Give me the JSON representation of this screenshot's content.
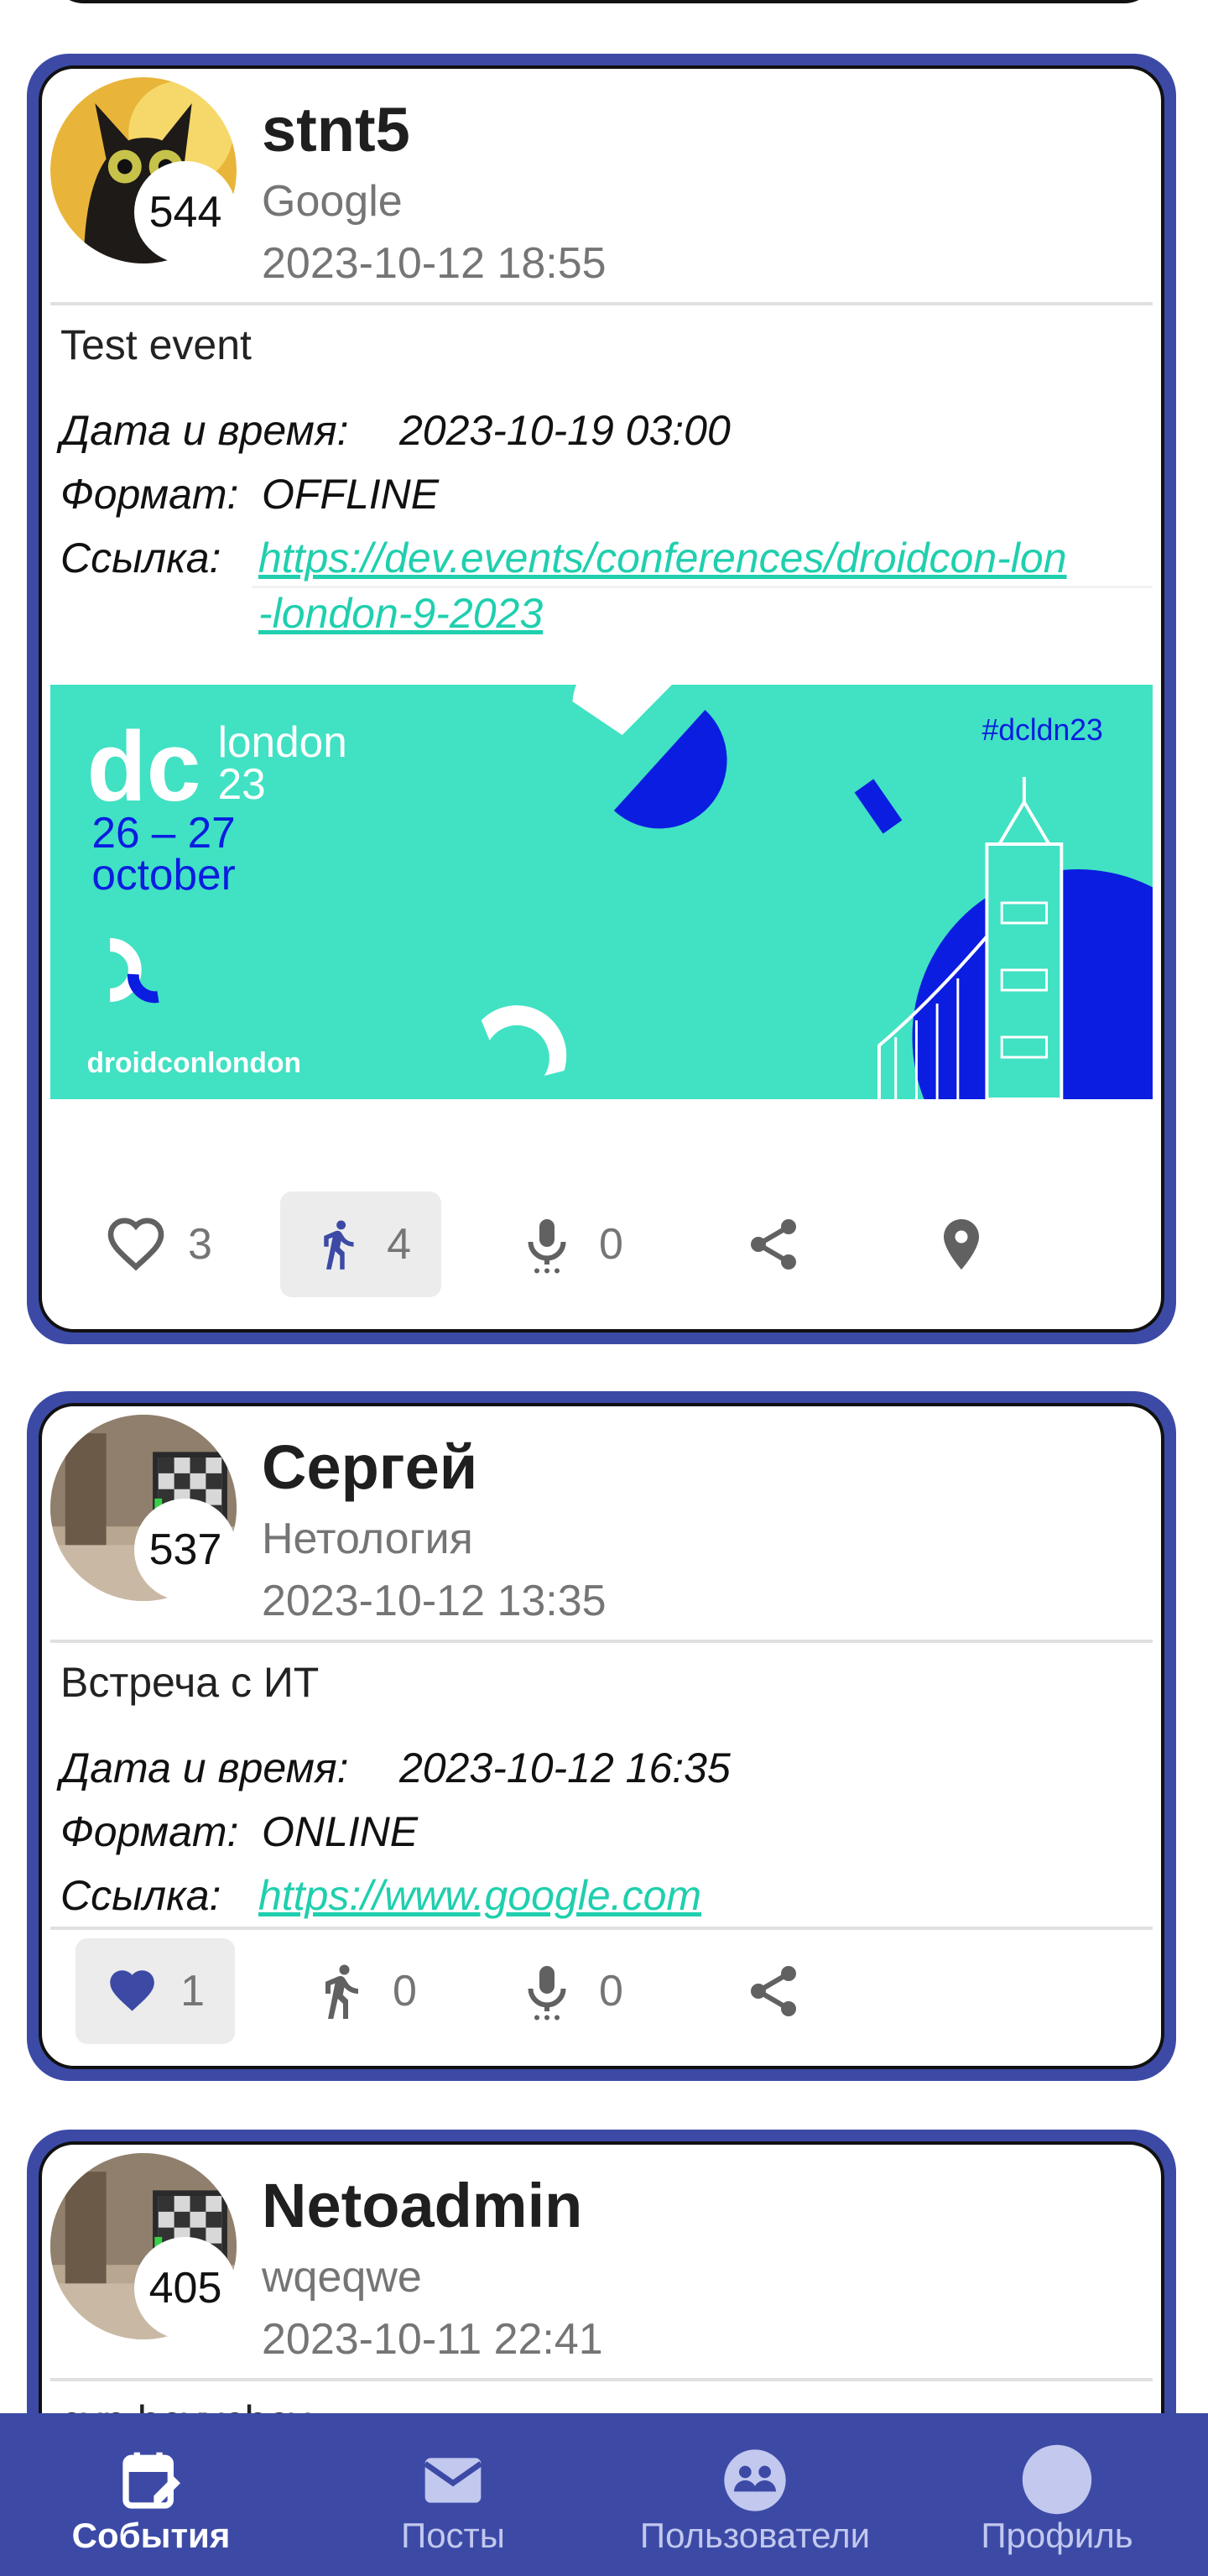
{
  "posts": [
    {
      "author": "stnt5",
      "job": "Google",
      "published": "2023-10-12 18:55",
      "badge": "544",
      "content": "Test event",
      "datetime_label": "Дата и время:",
      "datetime_value": "2023-10-19 03:00",
      "format_label": "Формат:",
      "format_value": "OFFLINE",
      "link_label": "Ссылка:",
      "link_line1": "https://dev.events/conferences/droidcon-lon",
      "link_line2": "-london-9-2023",
      "banner": {
        "dc": "dc",
        "city": "london",
        "year": "23",
        "dates": "26 – 27",
        "month": "october",
        "hashtag": "#dcldn23",
        "brand": "droidconlondon"
      },
      "likes": "3",
      "participants": "4",
      "speakers": "0"
    },
    {
      "author": "Сергей",
      "job": "Нетология",
      "published": "2023-10-12 13:35",
      "badge": "537",
      "content": "Встреча с ИТ",
      "datetime_label": "Дата и время:",
      "datetime_value": "2023-10-12 16:35",
      "format_label": "Формат:",
      "format_value": "ONLINE",
      "link_label": "Ссылка:",
      "link_line1": "https://www.google.com",
      "likes": "1",
      "participants": "0",
      "speakers": "0"
    },
    {
      "author": "Netoadmin",
      "job": "wqeqwe",
      "published": "2023-10-11 22:41",
      "badge": "405",
      "content": "cyn bcyvcbcy"
    }
  ],
  "nav": {
    "events": "События",
    "posts": "Посты",
    "users": "Пользователи",
    "profile": "Профиль"
  },
  "colors": {
    "primary": "#3c4aa6",
    "accent_link": "#1fcfae",
    "banner_teal": "#41e1c3",
    "banner_blue": "#0a1de0"
  }
}
